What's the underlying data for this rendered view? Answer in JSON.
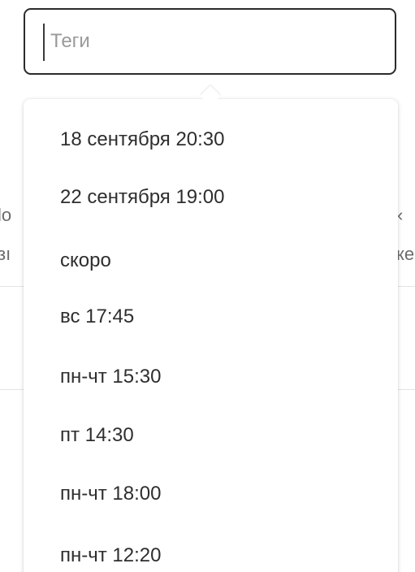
{
  "tags_field": {
    "placeholder": "Теги",
    "value": ""
  },
  "background": {
    "left_fragments": [
      "lo",
      "зı"
    ],
    "right_fragments": [
      "‹",
      "ке"
    ]
  },
  "dropdown": {
    "items": [
      {
        "label": "18 сентября 20:30"
      },
      {
        "label": "22 сентября 19:00"
      },
      {
        "label": "скоро"
      },
      {
        "label": "вс 17:45"
      },
      {
        "label": "пн-чт 15:30"
      },
      {
        "label": "пт 14:30"
      },
      {
        "label": "пн-чт 18:00"
      },
      {
        "label": "пн-чт 12:20"
      }
    ]
  }
}
